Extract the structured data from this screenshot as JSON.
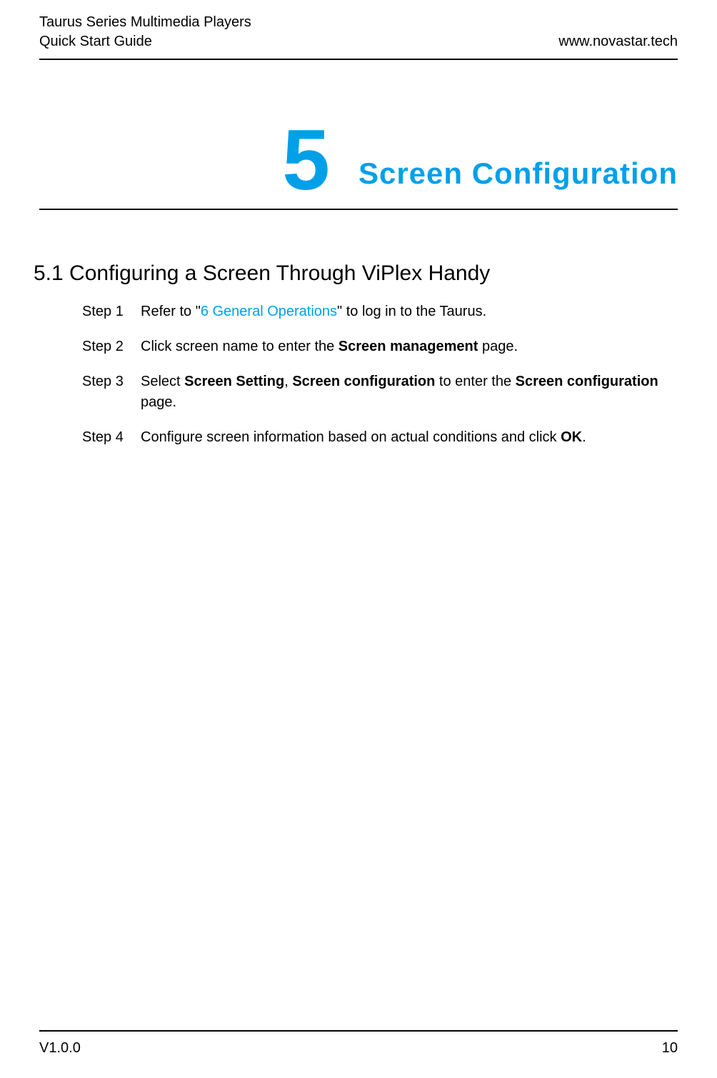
{
  "header": {
    "line1": "Taurus Series Multimedia Players",
    "line2": "Quick Start Guide",
    "right": "www.novastar.tech"
  },
  "chapter": {
    "number": "5",
    "title": "Screen  Configuration"
  },
  "section": {
    "heading": "5.1  Configuring a Screen Through ViPlex Handy"
  },
  "steps": {
    "s1": {
      "label": "Step 1",
      "pre": "Refer to \"",
      "link": "6 General Operations",
      "post": "\" to log in to the Taurus."
    },
    "s2": {
      "label": "Step 2",
      "t1": "Click screen name to enter the ",
      "b1": "Screen management",
      "t2": " page."
    },
    "s3": {
      "label": "Step 3",
      "t1": "Select ",
      "b1": "Screen Setting",
      "t2": ", ",
      "b2": "Screen configuration",
      "t3": " to enter the ",
      "b3": "Screen configuration",
      "t4": " page."
    },
    "s4": {
      "label": "Step 4",
      "t1": "Configure screen information based on actual conditions and click ",
      "b1": "OK",
      "t2": "."
    }
  },
  "footer": {
    "version": "V1.0.0",
    "page": "10"
  }
}
